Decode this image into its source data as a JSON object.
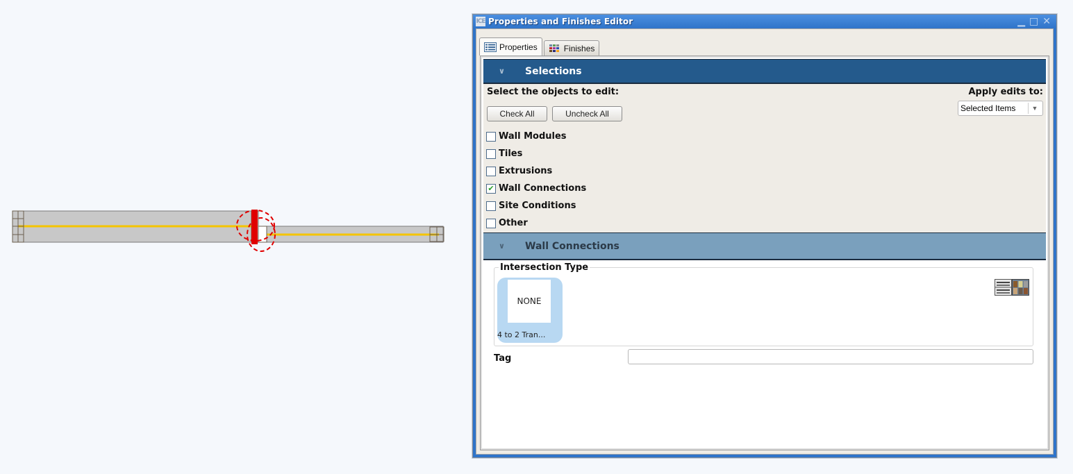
{
  "window": {
    "title": "Properties and Finishes Editor",
    "app_icon": "ICE",
    "controls": {
      "minimize": "minimize-icon",
      "maximize": "maximize-icon",
      "close": "close-icon"
    }
  },
  "tabs": [
    {
      "label": "Properties",
      "icon": "list-icon",
      "active": true
    },
    {
      "label": "Finishes",
      "icon": "color-grid-icon",
      "active": false
    }
  ],
  "selections": {
    "header": "Selections",
    "prompt": "Select the objects to edit:",
    "check_all_label": "Check All",
    "uncheck_all_label": "Uncheck All",
    "apply_label": "Apply edits to:",
    "apply_value": "Selected Items",
    "items": [
      {
        "label": "Wall Modules",
        "checked": false
      },
      {
        "label": "Tiles",
        "checked": false
      },
      {
        "label": "Extrusions",
        "checked": false
      },
      {
        "label": "Wall Connections",
        "checked": true
      },
      {
        "label": "Site Conditions",
        "checked": false
      },
      {
        "label": "Other",
        "checked": false
      }
    ]
  },
  "wall_connections": {
    "header": "Wall Connections",
    "intersection_type_label": "Intersection Type",
    "selected_type": {
      "thumb_text": "NONE",
      "caption": "4 to 2 Tran..."
    },
    "tag_label": "Tag",
    "tag_value": ""
  },
  "colors": {
    "section_dark": "#245a8c",
    "section_light": "#7aa0bd",
    "wall_fill": "#c8c8c8",
    "centerline": "#f5c400",
    "highlight": "#e00000",
    "window_frame": "#2f74c9"
  }
}
